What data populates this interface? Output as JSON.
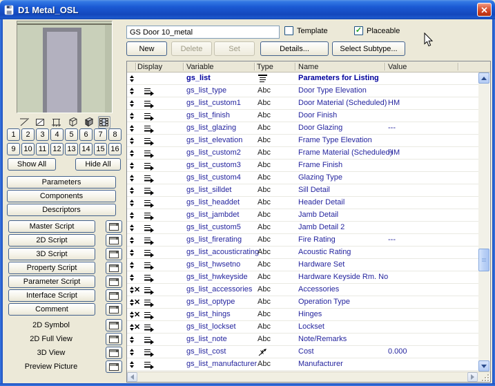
{
  "window": {
    "title": "D1 Metal_OSL"
  },
  "header": {
    "name_value": "GS Door 10_metal",
    "template_label": "Template",
    "template_checked": false,
    "placeable_label": "Placeable",
    "placeable_checked": true,
    "action_buttons": [
      {
        "label": "New",
        "enabled": true
      },
      {
        "label": "Delete",
        "enabled": false
      },
      {
        "label": "Set",
        "enabled": false
      },
      {
        "label": "Details...",
        "enabled": true
      },
      {
        "label": "Select Subtype...",
        "enabled": true
      }
    ]
  },
  "sidebar": {
    "preview_icons": [
      "line-2d-icon",
      "hatch-2d-icon",
      "section-icon",
      "wire-3d-cube-icon",
      "solid-3d-cube-icon",
      "film-preview-icon"
    ],
    "preview_selected_index": 5,
    "number_buttons": [
      "1",
      "2",
      "3",
      "4",
      "5",
      "6",
      "7",
      "8",
      "9",
      "10",
      "11",
      "12",
      "13",
      "14",
      "15",
      "16"
    ],
    "show_all": "Show All",
    "hide_all": "Hide All",
    "section_buttons": [
      "Parameters",
      "Components",
      "Descriptors"
    ],
    "script_buttons": [
      "Master Script",
      "2D Script",
      "3D Script",
      "Property Script",
      "Parameter Script",
      "Interface Script",
      "Comment"
    ],
    "view_labels": [
      "2D Symbol",
      "2D Full View",
      "3D View",
      "Preview Picture"
    ]
  },
  "table": {
    "columns": [
      "Display",
      "Variable",
      "Type",
      "Name",
      "Value"
    ],
    "rows": [
      {
        "variable": "gs_list",
        "type": "list",
        "name": "Parameters for Listing",
        "value": "",
        "display": false,
        "x": false,
        "bold": true
      },
      {
        "variable": "gs_list_type",
        "type": "Abc",
        "name": "Door Type Elevation",
        "value": "",
        "display": true,
        "x": false
      },
      {
        "variable": "gs_list_custom1",
        "type": "Abc",
        "name": "Door Material (Scheduled)",
        "value": "HM",
        "display": true,
        "x": false
      },
      {
        "variable": "gs_list_finish",
        "type": "Abc",
        "name": "Door Finish",
        "value": "",
        "display": true,
        "x": false
      },
      {
        "variable": "gs_list_glazing",
        "type": "Abc",
        "name": "Door Glazing",
        "value": "---",
        "display": true,
        "x": false
      },
      {
        "variable": "gs_list_elevation",
        "type": "Abc",
        "name": "Frame Type Elevation",
        "value": "",
        "display": true,
        "x": false
      },
      {
        "variable": "gs_list_custom2",
        "type": "Abc",
        "name": "Frame Material (Scheduled)",
        "value": "HM",
        "display": true,
        "x": false
      },
      {
        "variable": "gs_list_custom3",
        "type": "Abc",
        "name": "Frame Finish",
        "value": "",
        "display": true,
        "x": false
      },
      {
        "variable": "gs_list_custom4",
        "type": "Abc",
        "name": "Glazing Type",
        "value": "",
        "display": true,
        "x": false
      },
      {
        "variable": "gs_list_silldet",
        "type": "Abc",
        "name": "Sill Detail",
        "value": "",
        "display": true,
        "x": false
      },
      {
        "variable": "gs_list_headdet",
        "type": "Abc",
        "name": "Header Detail",
        "value": "",
        "display": true,
        "x": false
      },
      {
        "variable": "gs_list_jambdet",
        "type": "Abc",
        "name": "Jamb Detail",
        "value": "",
        "display": true,
        "x": false
      },
      {
        "variable": "gs_list_custom5",
        "type": "Abc",
        "name": "Jamb Detail 2",
        "value": "",
        "display": true,
        "x": false
      },
      {
        "variable": "gs_list_firerating",
        "type": "Abc",
        "name": "Fire Rating",
        "value": "---",
        "display": true,
        "x": false
      },
      {
        "variable": "gs_list_acousticrating",
        "type": "Abc",
        "name": "Acoustic Rating",
        "value": "",
        "display": true,
        "x": false
      },
      {
        "variable": "gs_list_hwsetno",
        "type": "Abc",
        "name": "Hardware Set",
        "value": "",
        "display": true,
        "x": false
      },
      {
        "variable": "gs_list_hwkeyside",
        "type": "Abc",
        "name": "Hardware Keyside Rm. No",
        "value": "",
        "display": true,
        "x": false
      },
      {
        "variable": "gs_list_accessories",
        "type": "Abc",
        "name": "Accessories",
        "value": "",
        "display": true,
        "x": true
      },
      {
        "variable": "gs_list_optype",
        "type": "Abc",
        "name": "Operation Type",
        "value": "",
        "display": true,
        "x": true
      },
      {
        "variable": "gs_list_hings",
        "type": "Abc",
        "name": "Hinges",
        "value": "",
        "display": true,
        "x": true
      },
      {
        "variable": "gs_list_lockset",
        "type": "Abc",
        "name": "Lockset",
        "value": "",
        "display": true,
        "x": true
      },
      {
        "variable": "gs_list_note",
        "type": "Abc",
        "name": "Note/Remarks",
        "value": "",
        "display": true,
        "x": false
      },
      {
        "variable": "gs_list_cost",
        "type": "length",
        "name": "Cost",
        "value": "0.000",
        "display": true,
        "x": false
      },
      {
        "variable": "gs_list_manufacturer",
        "type": "Abc",
        "name": "Manufacturer",
        "value": "",
        "display": true,
        "x": false
      }
    ]
  }
}
